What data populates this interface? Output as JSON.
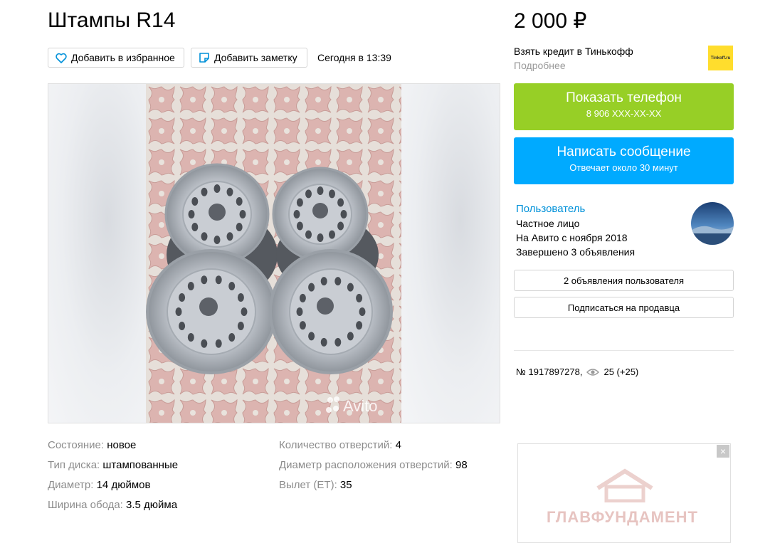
{
  "listing": {
    "title": "Штампы R14",
    "posted": "Сегодня в 13:39",
    "favorite_label": "Добавить в избранное",
    "note_label": "Добавить заметку",
    "watermark": "Avito"
  },
  "price": {
    "value": "2 000 ₽",
    "credit_title": "Взять кредит в Тинькофф",
    "credit_more": "Подробнее",
    "bank_logo_text": "Tinkoff.ru"
  },
  "actions": {
    "phone_title": "Показать телефон",
    "phone_number": "8 906 XXX-XX-XX",
    "message_title": "Написать сообщение",
    "message_sub": "Отвечает около 30 минут"
  },
  "seller": {
    "name": "Пользователь",
    "type": "Частное лицо",
    "since": "На Авито с ноября 2018",
    "completed": "Завершено 3 объявления",
    "listings_button": "2 объявления пользователя",
    "subscribe_button": "Подписаться на продавца"
  },
  "meta": {
    "item_number": "№ 1917897278,",
    "views": "25 (+25)"
  },
  "params": [
    {
      "key": "Состояние:",
      "value": "новое"
    },
    {
      "key": "Тип диска:",
      "value": "штампованные"
    },
    {
      "key": "Диаметр:",
      "value": "14 дюймов"
    },
    {
      "key": "Ширина обода:",
      "value": "3.5 дюйма"
    },
    {
      "key": "Количество отверстий:",
      "value": "4"
    },
    {
      "key": "Диаметр расположения отверстий:",
      "value": "98"
    },
    {
      "key": "Вылет (ET):",
      "value": "35"
    }
  ],
  "ad": {
    "close": "×",
    "text": "ГЛАВФУНДАМЕНТ"
  },
  "colors": {
    "phone_button": "#97cf26",
    "message_button": "#00aaff",
    "seller_link": "#0091d9",
    "tinkoff": "#ffdd2d"
  }
}
